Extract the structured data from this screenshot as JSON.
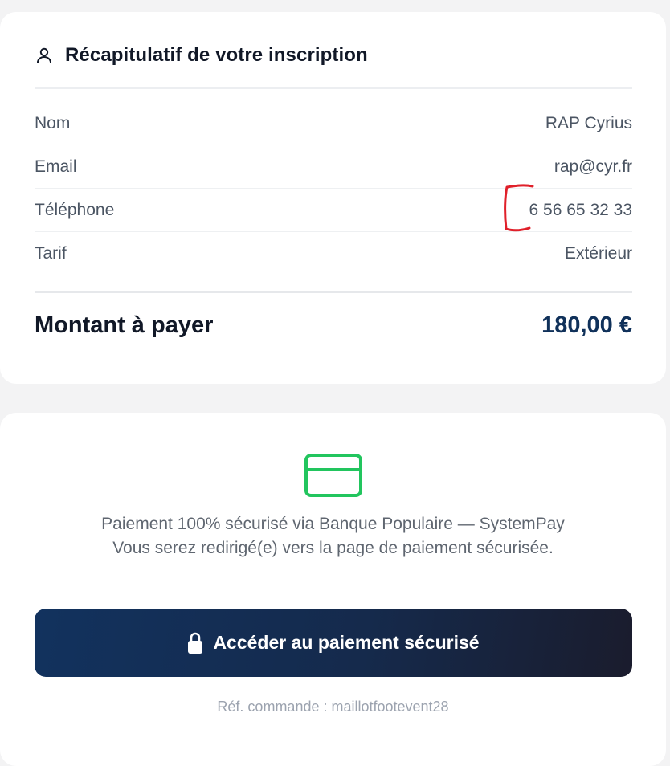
{
  "summary": {
    "title": "Récapitulatif de votre inscription",
    "icon": "user-icon",
    "rows": [
      {
        "label": "Nom",
        "value": "RAP Cyrius"
      },
      {
        "label": "Email",
        "value": "rap@cyr.fr"
      },
      {
        "label": "Téléphone",
        "value": "6 56 65 32 33"
      },
      {
        "label": "Tarif",
        "value": "Extérieur"
      }
    ],
    "total_label": "Montant à payer",
    "total_value": "180,00 €"
  },
  "payment": {
    "icon": "credit-card-icon",
    "line1": "Paiement 100% sécurisé via Banque Populaire — SystemPay",
    "line2": "Vous serez redirigé(e) vers la page de paiement sécurisée.",
    "button_label": "Accéder au paiement sécurisé",
    "button_icon": "lock-icon",
    "reference": "Réf. commande : maillotfootevent28"
  },
  "colors": {
    "accent_green": "#22c55e",
    "button_dark": "#12325e",
    "total_blue": "#10315a",
    "annotation_red": "#e0202a"
  }
}
